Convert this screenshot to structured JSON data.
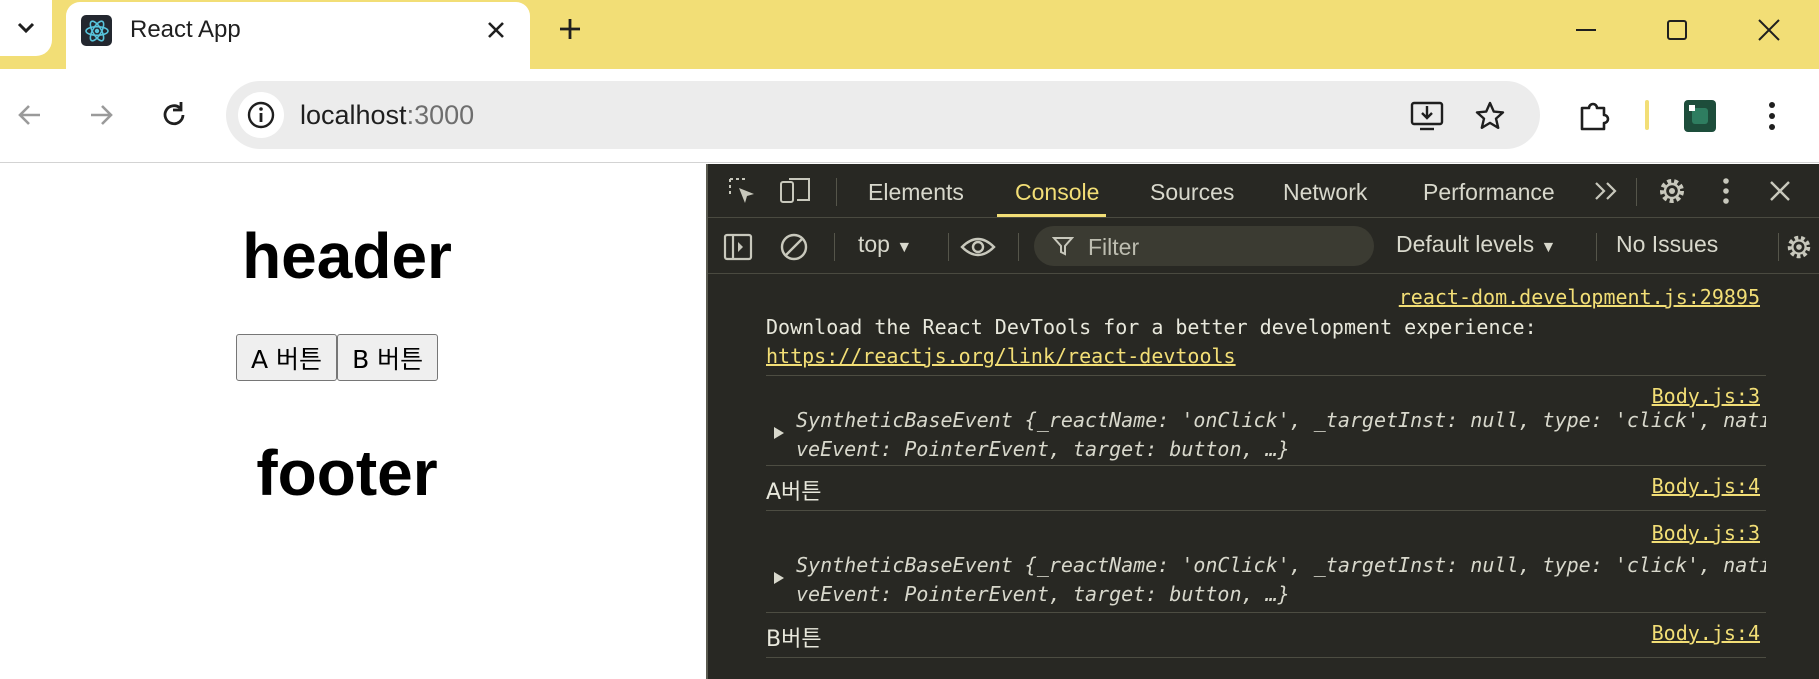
{
  "browser": {
    "tab": {
      "title": "React App",
      "favicon": "react-atom-icon"
    },
    "url": {
      "host": "localhost",
      "port": ":3000"
    },
    "icons": {
      "tab_dropdown": "chevron-down-icon",
      "new_tab": "plus-icon",
      "back": "arrow-left-icon",
      "forward": "arrow-right-icon",
      "reload": "reload-icon",
      "site_info": "info-icon",
      "install": "install-app-icon",
      "bookmark": "star-icon",
      "extensions": "puzzle-icon",
      "profile": "profile-avatar",
      "menu": "kebab-icon"
    }
  },
  "page": {
    "header": "header",
    "button_a": "A 버튼",
    "button_b": "B 버튼",
    "footer": "footer"
  },
  "devtools": {
    "tabs": [
      "Elements",
      "Console",
      "Sources",
      "Network",
      "Performance"
    ],
    "active_tab": "Console",
    "context": "top",
    "filter_placeholder": "Filter",
    "levels": "Default levels",
    "issues": "No Issues",
    "messages": [
      {
        "source": "react-dom.development.js:29895",
        "text": "Download the React DevTools for a better development experience: ",
        "link": "https://reactjs.org/link/react-devtools"
      },
      {
        "source": "Body.js:3",
        "object_line1": "SyntheticBaseEvent {_reactName: 'onClick', _targetInst: null, type: 'click', nati",
        "object_line2": "veEvent: PointerEvent, target: button, …}"
      },
      {
        "source": "Body.js:4",
        "text": "A버튼"
      },
      {
        "source": "Body.js:3",
        "object_line1": "SyntheticBaseEvent {_reactName: 'onClick', _targetInst: null, type: 'click', nati",
        "object_line2": "veEvent: PointerEvent, target: button, …}"
      },
      {
        "source": "Body.js:4",
        "text": "B버튼"
      }
    ]
  },
  "colors": {
    "tabstrip": "#f2de76",
    "devtools_bg": "#282823",
    "accent": "#f2de76"
  }
}
